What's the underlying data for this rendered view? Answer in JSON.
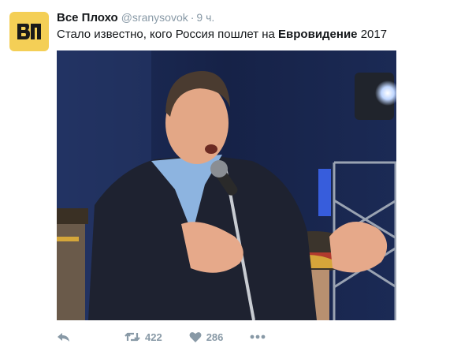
{
  "account": {
    "avatar_icon": "vp-logo-icon",
    "avatar_text": "ВП",
    "name": "Все Плохо",
    "handle": "@sranysovok",
    "separator": "·",
    "time": "9 ч."
  },
  "tweet": {
    "text_prefix": "Стало известно, кого Россия пошлет на ",
    "text_bold": "Евровидение",
    "text_suffix": " 2017"
  },
  "media": {
    "description_icon": "photo"
  },
  "actions": {
    "reply_icon": "reply-icon",
    "retweet_icon": "retweet-icon",
    "retweet_count": "422",
    "like_icon": "heart-icon",
    "like_count": "286",
    "more_icon": "more-icon"
  },
  "colors": {
    "avatar_bg": "#f4cf56",
    "text": "#14171a",
    "muted": "#8899a6"
  }
}
